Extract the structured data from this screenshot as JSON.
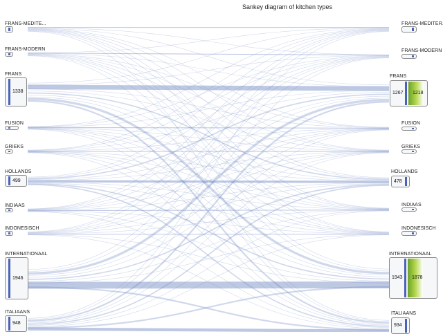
{
  "title": "Sankey diagram of kitchen types",
  "left_nodes": [
    {
      "id": "frans_mediter",
      "label": "FRANS-MEDITE...",
      "value": ""
    },
    {
      "id": "frans_modern",
      "label": "FRANS-MODERN",
      "value": ""
    },
    {
      "id": "frans",
      "label": "FRANS",
      "value": "1338"
    },
    {
      "id": "fusion",
      "label": "FUSION",
      "value": ""
    },
    {
      "id": "grieks",
      "label": "GRIEKS",
      "value": ""
    },
    {
      "id": "hollands",
      "label": "HOLLANDS",
      "value": "499"
    },
    {
      "id": "indiaas",
      "label": "INDIAAS",
      "value": ""
    },
    {
      "id": "indonesisch",
      "label": "INDONESISCH",
      "value": ""
    },
    {
      "id": "internationaal",
      "label": "INTERNATIONAAL",
      "value": "1946"
    },
    {
      "id": "italiaans",
      "label": "ITALIAANS",
      "value": "948"
    }
  ],
  "right_nodes": [
    {
      "id": "frans_mediter",
      "label": "FRANS-MEDITER...",
      "value": "",
      "value2": ""
    },
    {
      "id": "frans_modern",
      "label": "FRANS-MODERN",
      "value": "",
      "value2": ""
    },
    {
      "id": "frans",
      "label": "FRANS",
      "value": "1267",
      "value2": "1218"
    },
    {
      "id": "fusion",
      "label": "FUSION",
      "value": "",
      "value2": ""
    },
    {
      "id": "grieks",
      "label": "GRIEKS",
      "value": "",
      "value2": ""
    },
    {
      "id": "hollands",
      "label": "HOLLANDS",
      "value": "478",
      "value2": ""
    },
    {
      "id": "indiaas",
      "label": "INDIAAS",
      "value": "",
      "value2": ""
    },
    {
      "id": "indonesisch",
      "label": "INDONESISCH",
      "value": "",
      "value2": ""
    },
    {
      "id": "internationaal",
      "label": "INTERNATIONAAL",
      "value": "1943",
      "value2": "1878"
    },
    {
      "id": "italiaans",
      "label": "ITALIAANS",
      "value": "934",
      "value2": ""
    }
  ],
  "colors": {
    "flow": "#6d86c2",
    "bar": "#4a63b8",
    "bar2": "#8cc63e",
    "node_border": "#888888"
  }
}
